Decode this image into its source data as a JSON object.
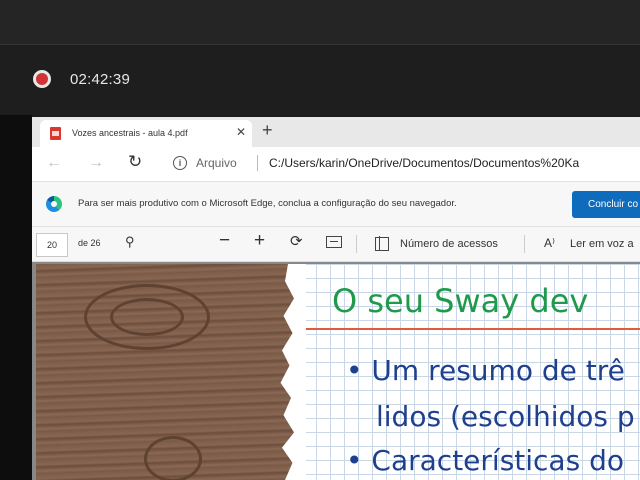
{
  "recorder": {
    "time": "02:42:39"
  },
  "browser": {
    "tab_title": "Vozes ancestrais - aula 4.pdf",
    "tab_close": "✕",
    "new_tab": "+",
    "address_label": "Arquivo",
    "address_url": "C:/Users/karin/OneDrive/Documentos/Documentos%20Ka",
    "info_text": "Para ser mais produtivo com o Microsoft Edge, conclua a configuração do seu navegador.",
    "info_button": "Concluir co"
  },
  "pdf_toolbar": {
    "page": "20",
    "page_of": "de 26",
    "access_label": "Número de acessos",
    "read_label": "Ler em voz a"
  },
  "slide": {
    "title": "O seu Sway dev",
    "bullet1_line1": "Um resumo de trê",
    "bullet1_line2": "lidos (escolhidos p",
    "bullet2": "Características do"
  }
}
